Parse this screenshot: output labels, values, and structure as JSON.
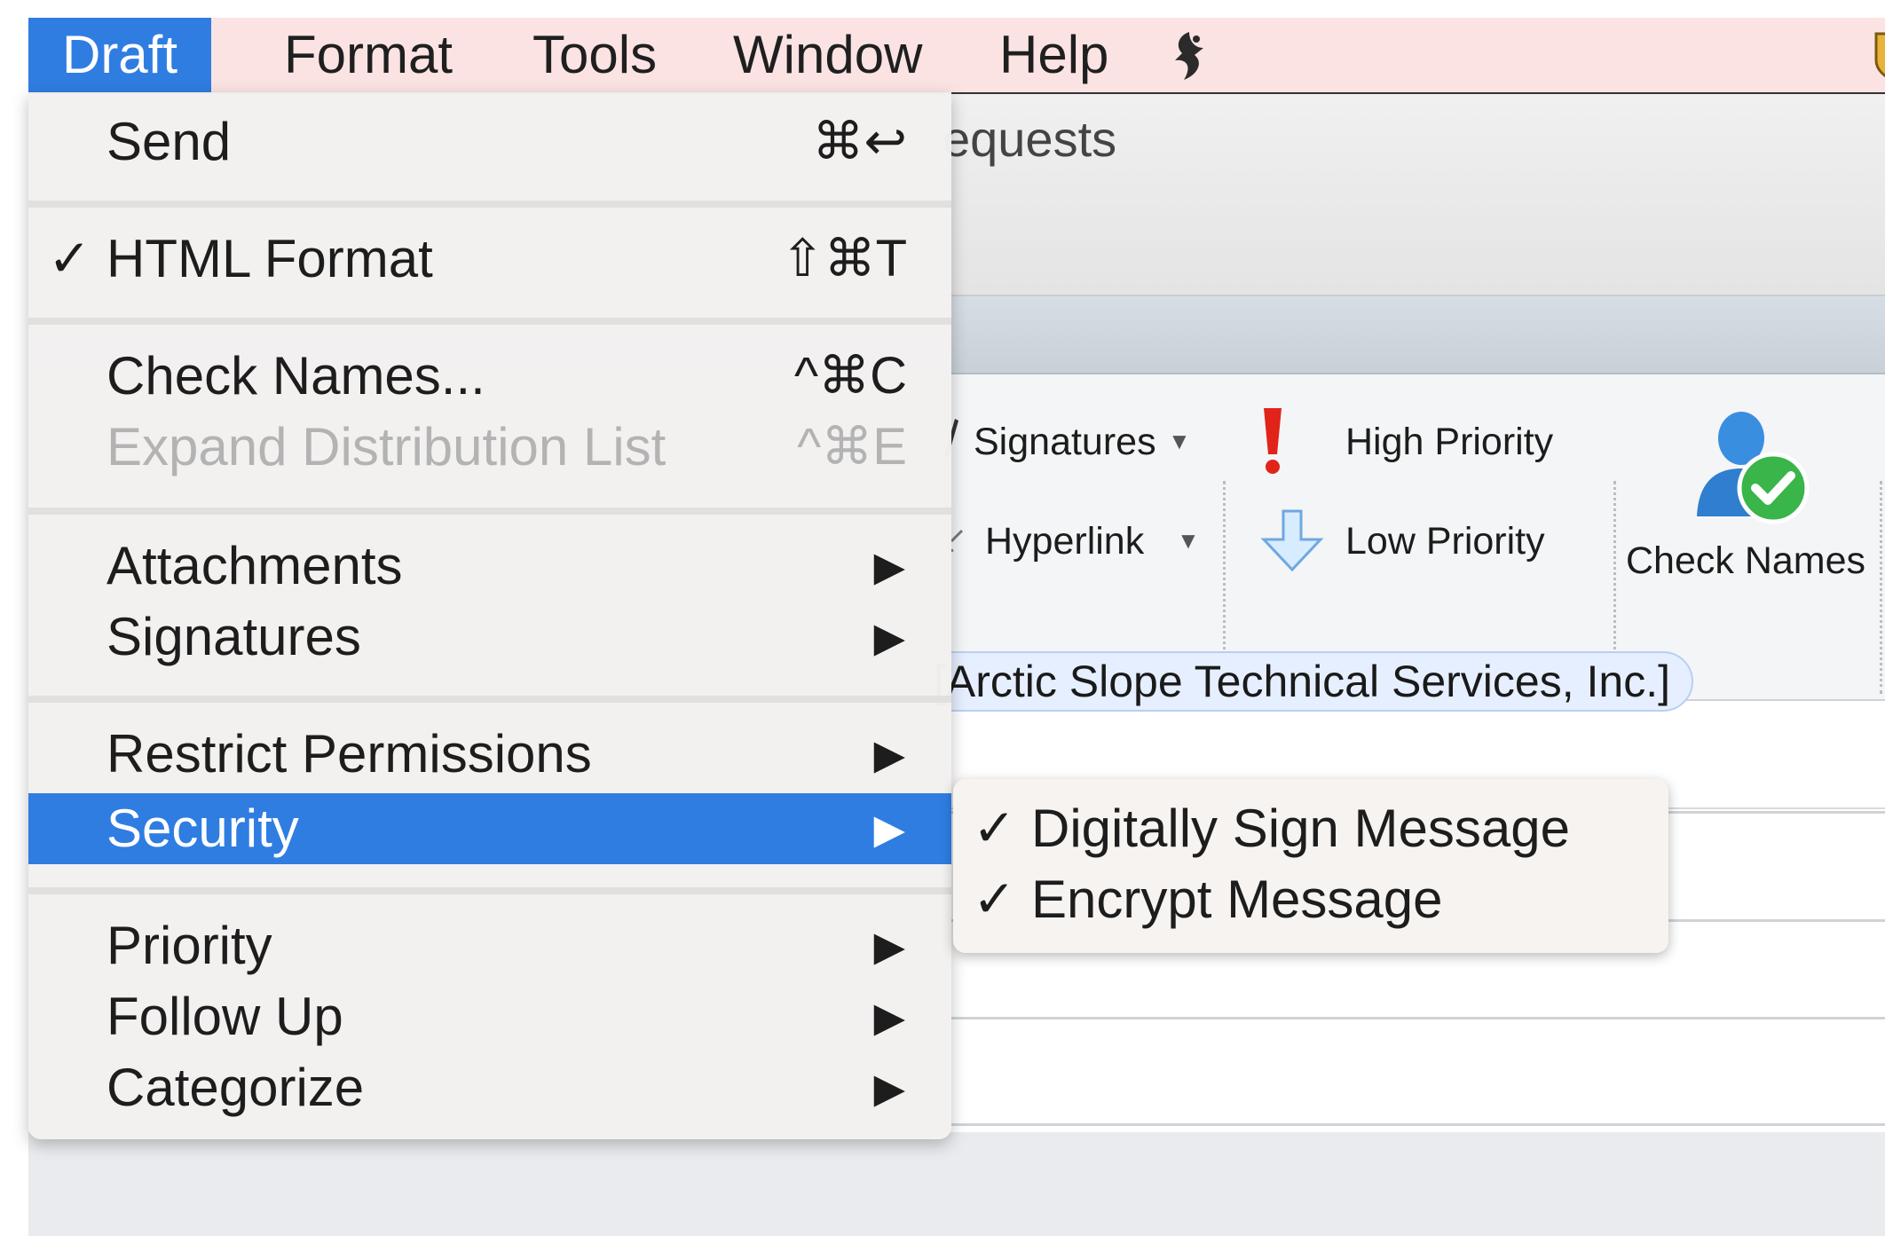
{
  "menubar": {
    "items": [
      {
        "label": "Draft"
      },
      {
        "label": "Format"
      },
      {
        "label": "Tools"
      },
      {
        "label": "Window"
      },
      {
        "label": "Help"
      }
    ],
    "script_icon": "script-icon",
    "shield_icon": "shield-icon"
  },
  "background": {
    "window_title_fragment": "equests",
    "ribbon": {
      "signatures_label": "Signatures",
      "hyperlink_label": "Hyperlink",
      "high_priority_label": "High Priority",
      "low_priority_label": "Low Priority",
      "check_names_label": "Check Names"
    },
    "recipient": "[Arctic Slope Technical Services, Inc.]"
  },
  "draft_menu": {
    "items": [
      {
        "label": "Send",
        "shortcut": "⌘↩"
      },
      {
        "label": "HTML Format",
        "shortcut": "⇧⌘T",
        "checked": "✓"
      },
      {
        "label": "Check Names...",
        "shortcut": "^⌘C"
      },
      {
        "label": "Expand Distribution List",
        "shortcut": "^⌘E",
        "disabled": true
      },
      {
        "label": "Attachments"
      },
      {
        "label": "Signatures"
      },
      {
        "label": "Restrict Permissions"
      },
      {
        "label": "Security",
        "selected": true
      },
      {
        "label": "Priority"
      },
      {
        "label": "Follow Up"
      },
      {
        "label": "Categorize"
      }
    ],
    "submenu_arrow": "▶"
  },
  "security_submenu": {
    "items": [
      {
        "label": "Digitally Sign Message",
        "checked": "✓"
      },
      {
        "label": "Encrypt Message",
        "checked": "✓"
      }
    ]
  },
  "colors": {
    "menubar_bg": "#fbe3e3",
    "selection_blue": "#2f7de1",
    "menu_bg": "#f3f1f0",
    "disabled_text": "#b3b3b3"
  }
}
